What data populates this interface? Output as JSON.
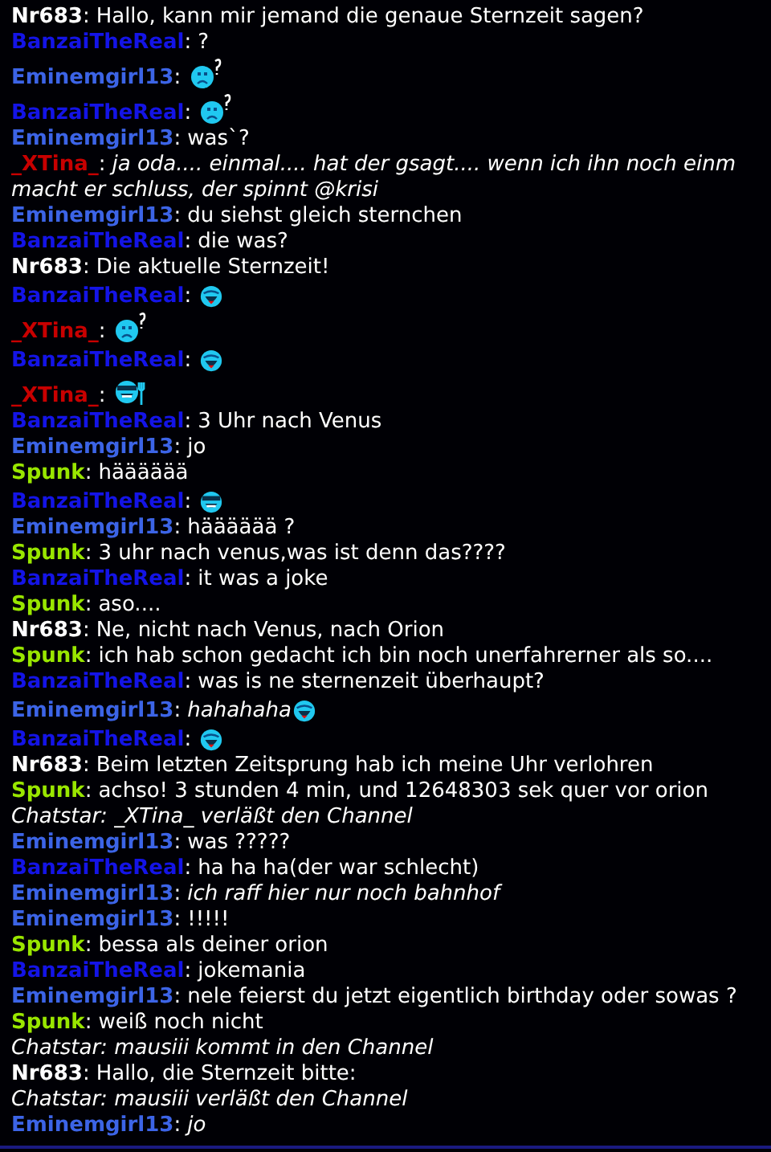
{
  "messages": [
    {
      "kind": "message",
      "user": "Nr683",
      "color": "#ffffff",
      "separator": ":",
      "text": "Hallo, kann mir jemand die genaue Sternzeit sagen?"
    },
    {
      "kind": "message",
      "user": "BanzaiTheReal",
      "color": "#1414e6",
      "separator": ":",
      "text": "?"
    },
    {
      "kind": "message",
      "user": "Eminemgirl13",
      "color": "#3c64e6",
      "separator": ":",
      "smiley": {
        "kind": "puzzled"
      }
    },
    {
      "kind": "message",
      "user": "BanzaiTheReal",
      "color": "#1414e6",
      "separator": ":",
      "smiley": {
        "kind": "puzzled"
      }
    },
    {
      "kind": "message",
      "user": "Eminemgirl13",
      "color": "#3c64e6",
      "separator": ":",
      "text": "was`?"
    },
    {
      "kind": "message",
      "user": "_XTina_",
      "color": "#c80000",
      "separator": ":",
      "text": "ja oda.... einmal.... hat der gsagt.... wenn ich ihn noch einm",
      "italic": true
    },
    {
      "kind": "continuation",
      "text": "macht er schluss, der spinnt @krisi",
      "italic": true
    },
    {
      "kind": "message",
      "user": "Eminemgirl13",
      "color": "#3c64e6",
      "separator": ":",
      "text": "du siehst gleich sternchen"
    },
    {
      "kind": "message",
      "user": "BanzaiTheReal",
      "color": "#1414e6",
      "separator": ":",
      "text": "die was?"
    },
    {
      "kind": "message",
      "user": "Nr683",
      "color": "#ffffff",
      "separator": ":",
      "text": "Die aktuelle Sternzeit!"
    },
    {
      "kind": "message",
      "user": "BanzaiTheReal",
      "color": "#1414e6",
      "separator": ":",
      "smiley": {
        "kind": "laughing"
      }
    },
    {
      "kind": "message",
      "user": "_XTina_",
      "color": "#c80000",
      "separator": ":",
      "smiley": {
        "kind": "puzzled"
      }
    },
    {
      "kind": "message",
      "user": "BanzaiTheReal",
      "color": "#1414e6",
      "separator": ":",
      "smiley": {
        "kind": "laughing"
      }
    },
    {
      "kind": "message",
      "user": "_XTina_",
      "color": "#c80000",
      "separator": ":",
      "smiley": {
        "kind": "shades-fork"
      }
    },
    {
      "kind": "message",
      "user": "BanzaiTheReal",
      "color": "#1414e6",
      "separator": ":",
      "text": "3 Uhr nach Venus"
    },
    {
      "kind": "message",
      "user": "Eminemgirl13",
      "color": "#3c64e6",
      "separator": ":",
      "text": "jo"
    },
    {
      "kind": "message",
      "user": "Spunk",
      "color": "#99e600",
      "separator": ":",
      "text": "hääääää"
    },
    {
      "kind": "message",
      "user": "BanzaiTheReal",
      "color": "#1414e6",
      "separator": ":",
      "smiley": {
        "kind": "shades"
      }
    },
    {
      "kind": "message",
      "user": "Eminemgirl13",
      "color": "#3c64e6",
      "separator": ":",
      "text": "hääääää ?"
    },
    {
      "kind": "message",
      "user": "Spunk",
      "color": "#99e600",
      "separator": ":",
      "text": "3 uhr nach venus,was ist denn das????"
    },
    {
      "kind": "message",
      "user": "BanzaiTheReal",
      "color": "#1414e6",
      "separator": ":",
      "text": "it was a joke"
    },
    {
      "kind": "message",
      "user": "Spunk",
      "color": "#99e600",
      "separator": ":",
      "text": "aso...."
    },
    {
      "kind": "message",
      "user": "Nr683",
      "color": "#ffffff",
      "separator": ":",
      "text": "Ne, nicht nach Venus, nach Orion"
    },
    {
      "kind": "message",
      "user": "Spunk",
      "color": "#99e600",
      "separator": ":",
      "text": "ich hab schon gedacht ich bin noch unerfahrerner als so...."
    },
    {
      "kind": "message",
      "user": "BanzaiTheReal",
      "color": "#1414e6",
      "separator": ":",
      "text": "was is ne sternenzeit überhaupt?"
    },
    {
      "kind": "message",
      "user": "Eminemgirl13",
      "color": "#3c64e6",
      "separator": ":",
      "text": "hahahaha",
      "italic": true,
      "smiley": {
        "kind": "laughing"
      }
    },
    {
      "kind": "message",
      "user": "BanzaiTheReal",
      "color": "#1414e6",
      "separator": ":",
      "smiley": {
        "kind": "laughing"
      }
    },
    {
      "kind": "message",
      "user": "Nr683",
      "color": "#ffffff",
      "separator": ":",
      "text": "Beim letzten Zeitsprung hab ich meine Uhr verlohren"
    },
    {
      "kind": "message",
      "user": "Spunk",
      "color": "#99e600",
      "separator": ":",
      "text": "achso! 3 stunden 4 min, und 12648303 sek quer vor orion"
    },
    {
      "kind": "system",
      "text": "Chatstar: _XTina_ verläßt den Channel"
    },
    {
      "kind": "message",
      "user": "Eminemgirl13",
      "color": "#3c64e6",
      "separator": ":",
      "text": "was ?????"
    },
    {
      "kind": "message",
      "user": "BanzaiTheReal",
      "color": "#1414e6",
      "separator": ":",
      "text": "ha ha ha(der war schlecht)"
    },
    {
      "kind": "message",
      "user": "Eminemgirl13",
      "color": "#3c64e6",
      "separator": ":",
      "text": "ich raff hier nur noch bahnhof",
      "italic": true
    },
    {
      "kind": "message",
      "user": "Eminemgirl13",
      "color": "#3c64e6",
      "separator": ":",
      "text": "!!!!!"
    },
    {
      "kind": "message",
      "user": "Spunk",
      "color": "#99e600",
      "separator": ":",
      "text": "bessa als deiner orion"
    },
    {
      "kind": "message",
      "user": "BanzaiTheReal",
      "color": "#1414e6",
      "separator": ":",
      "text": "jokemania"
    },
    {
      "kind": "message",
      "user": "Eminemgirl13",
      "color": "#3c64e6",
      "separator": ":",
      "text": "nele feierst du jetzt eigentlich birthday oder sowas ?"
    },
    {
      "kind": "message",
      "user": "Spunk",
      "color": "#99e600",
      "separator": ":",
      "text": "weiß noch nicht"
    },
    {
      "kind": "system",
      "text": "Chatstar: mausiii kommt in den Channel"
    },
    {
      "kind": "message",
      "user": "Nr683",
      "color": "#ffffff",
      "separator": ":",
      "text": "Hallo, die Sternzeit bitte:"
    },
    {
      "kind": "system",
      "text": "Chatstar: mausiii verläßt den Channel"
    },
    {
      "kind": "message",
      "user": "Eminemgirl13",
      "color": "#3c64e6",
      "separator": ":",
      "text": "jo",
      "italic": true
    }
  ]
}
